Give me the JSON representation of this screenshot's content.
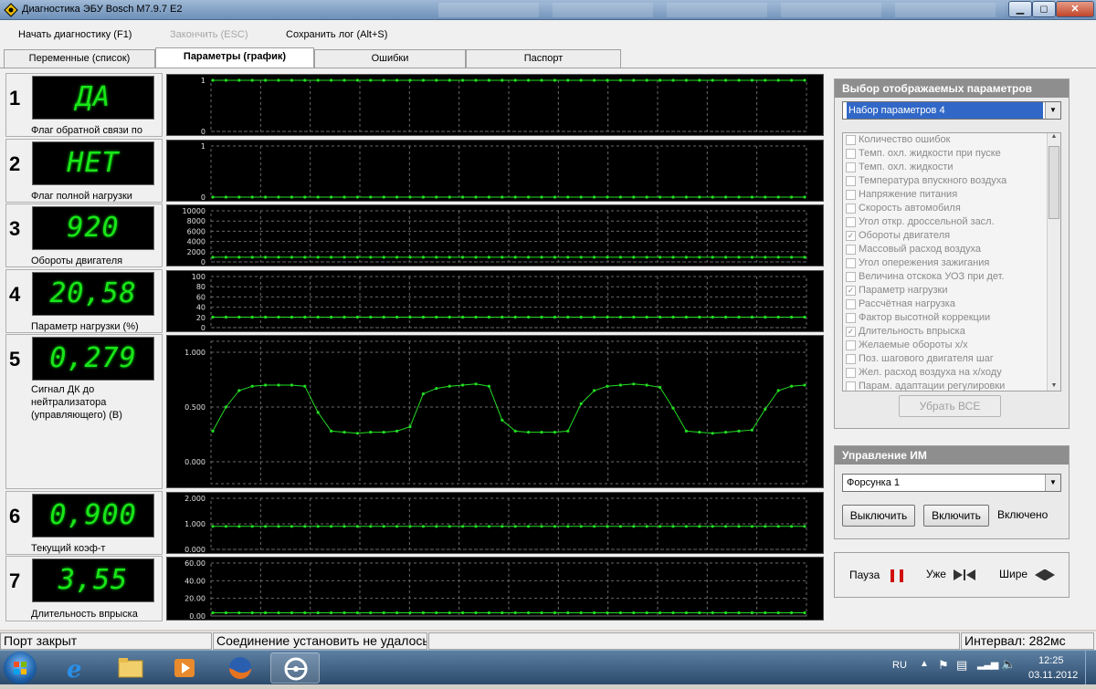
{
  "window": {
    "title": "Диагностика ЭБУ Bosch M7.9.7 E2",
    "controls": [
      "▁",
      "◻",
      "✕"
    ]
  },
  "menu": [
    {
      "label": "Начать диагностику (F1)",
      "enabled": true
    },
    {
      "label": "Закончить (ESC)",
      "enabled": false
    },
    {
      "label": "Сохранить лог (Alt+S)",
      "enabled": true
    }
  ],
  "tabs": [
    {
      "label": "Переменные (список)",
      "active": false
    },
    {
      "label": "Параметры (график)",
      "active": true
    },
    {
      "label": "Ошибки",
      "active": false
    },
    {
      "label": "Паспорт",
      "active": false
    }
  ],
  "rows": [
    {
      "num": "1",
      "lcd": "ДА",
      "label": "Флаг обратной связи по",
      "chart": {
        "yticks": [
          "1",
          "0"
        ],
        "ymin": 0,
        "ymax": 1,
        "values": [
          1
        ]
      }
    },
    {
      "num": "2",
      "lcd": "НЕТ",
      "label": "Флаг полной нагрузки",
      "chart": {
        "yticks": [
          "1",
          "0"
        ],
        "ymin": 0,
        "ymax": 1,
        "values": [
          0
        ]
      }
    },
    {
      "num": "3",
      "lcd": "920",
      "label": "Обороты двигателя",
      "chart": {
        "yticks": [
          "10000",
          "8000",
          "6000",
          "4000",
          "2000",
          "0"
        ],
        "ymin": 0,
        "ymax": 10000,
        "values": [
          920
        ]
      }
    },
    {
      "num": "4",
      "lcd": "20,58",
      "label": "Параметр нагрузки (%)",
      "chart": {
        "yticks": [
          "100",
          "80",
          "60",
          "40",
          "20",
          "0"
        ],
        "ymin": 0,
        "ymax": 100,
        "values": [
          20.6
        ]
      }
    },
    {
      "num": "5",
      "lcd": "0,279",
      "label": "Сигнал ДК до нейтрализатора (управляющего) (В)",
      "chart": {
        "yticks": [
          "1.000",
          "0.500",
          "0.000"
        ],
        "ymin": -0.2,
        "ymax": 1.1,
        "values": [
          0.28,
          0.5,
          0.65,
          0.69,
          0.7,
          0.7,
          0.7,
          0.69,
          0.45,
          0.28,
          0.27,
          0.26,
          0.27,
          0.27,
          0.28,
          0.32,
          0.62,
          0.67,
          0.69,
          0.7,
          0.71,
          0.69,
          0.38,
          0.28,
          0.27,
          0.27,
          0.27,
          0.28,
          0.53,
          0.65,
          0.69,
          0.7,
          0.71,
          0.7,
          0.68,
          0.49,
          0.28,
          0.27,
          0.26,
          0.27,
          0.28,
          0.29,
          0.48,
          0.65,
          0.69,
          0.7
        ]
      }
    },
    {
      "num": "6",
      "lcd": "0,900",
      "label": "Текущий коэф-т",
      "chart": {
        "yticks": [
          "2.000",
          "1.000",
          "0.000"
        ],
        "ymin": 0,
        "ymax": 2,
        "values": [
          0.9
        ]
      }
    },
    {
      "num": "7",
      "lcd": "3,55",
      "label": "Длительность впрыска",
      "chart": {
        "yticks": [
          "60.00",
          "40.00",
          "20.00",
          "0.00"
        ],
        "ymin": 0,
        "ymax": 60,
        "values": [
          3.6
        ]
      }
    }
  ],
  "param_panel": {
    "title": "Выбор отображаемых параметров",
    "set_selected": "Набор параметров 4",
    "items": [
      {
        "label": "Количество ошибок",
        "checked": false
      },
      {
        "label": "Темп. охл. жидкости при пуске",
        "checked": false
      },
      {
        "label": "Темп. охл. жидкости",
        "checked": false
      },
      {
        "label": "Температура впускного воздуха",
        "checked": false
      },
      {
        "label": "Напряжение питания",
        "checked": false
      },
      {
        "label": "Скорость автомобиля",
        "checked": false
      },
      {
        "label": "Угол откр. дроссельной засл.",
        "checked": false
      },
      {
        "label": "Обороты двигателя",
        "checked": true
      },
      {
        "label": "Массовый расход воздуха",
        "checked": false
      },
      {
        "label": "Угол опережения зажигания",
        "checked": false
      },
      {
        "label": "Величина отскока УОЗ при дет.",
        "checked": false
      },
      {
        "label": "Параметр нагрузки",
        "checked": true
      },
      {
        "label": "Рассчётная нагрузка",
        "checked": false
      },
      {
        "label": "Фактор высотной коррекции",
        "checked": false
      },
      {
        "label": "Длительность впрыска",
        "checked": true
      },
      {
        "label": "Желаемые обороты х/х",
        "checked": false
      },
      {
        "label": "Поз. шагового двигателя шаг",
        "checked": false
      },
      {
        "label": "Жел. расход воздуха на х/ходу",
        "checked": false
      },
      {
        "label": "Парам. адаптации регулировки",
        "checked": false
      }
    ],
    "remove_all": "Убрать ВСЕ"
  },
  "actuator_panel": {
    "title": "Управление ИМ",
    "selected": "Форсунка 1",
    "off_button": "Выключить",
    "on_button": "Включить",
    "state": "Включено"
  },
  "playback": {
    "pause": "Пауза",
    "narrow": "Уже",
    "wider": "Шире"
  },
  "statusbar": {
    "port": "Порт закрыт",
    "connection": "Соединение установить не удалось",
    "interval": "Интервал: 282мс"
  },
  "taskbar": {
    "lang": "RU",
    "time": "12:25",
    "date": "03.11.2012"
  },
  "colors": {
    "lcd_green": "#19e619",
    "plot_green": "#22dd22",
    "grid": "#6a6a6a",
    "accent_select": "#3168c7"
  }
}
